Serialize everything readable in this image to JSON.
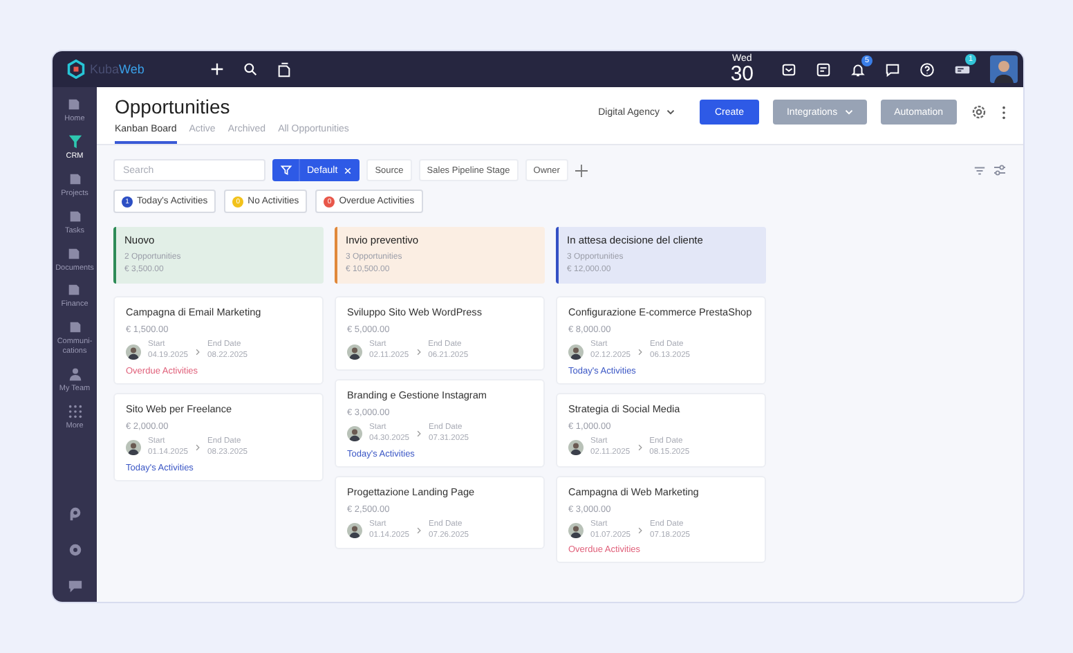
{
  "logo": {
    "first": "Kuba",
    "second": "Web"
  },
  "topbar": {
    "day": "Wed",
    "date": "30",
    "notifications": "5",
    "messages_badge": "1"
  },
  "sidebar": {
    "items": [
      {
        "label": "Home",
        "selected": false
      },
      {
        "label": "CRM",
        "selected": true
      },
      {
        "label": "Projects",
        "selected": false
      },
      {
        "label": "Tasks",
        "selected": false
      },
      {
        "label": "Documents",
        "selected": false
      },
      {
        "label": "Finance",
        "selected": false
      },
      {
        "label": "Communi-\ncations",
        "selected": false
      },
      {
        "label": "My Team",
        "selected": false
      },
      {
        "label": "More",
        "selected": false
      }
    ]
  },
  "header": {
    "title": "Opportunities",
    "tabs": [
      {
        "label": "Kanban Board",
        "selected": true
      },
      {
        "label": "Active",
        "selected": false
      },
      {
        "label": "Archived",
        "selected": false
      },
      {
        "label": "All Opportunities",
        "selected": false
      }
    ],
    "workspace": "Digital Agency",
    "buttons": [
      {
        "label": "Create",
        "kind": "primary"
      },
      {
        "label": "Integrations",
        "kind": "dropdown"
      },
      {
        "label": "Automation",
        "kind": "secondary"
      }
    ]
  },
  "filters": {
    "search_placeholder": "Search",
    "active_filter": "Default",
    "options": [
      "Source",
      "Sales Pipeline Stage",
      "Owner"
    ]
  },
  "activity_filters": [
    {
      "count": "1",
      "label": "Today's Activities",
      "color": "#2d4fc4"
    },
    {
      "count": "0",
      "label": "No Activities",
      "color": "#f2c21b"
    },
    {
      "count": "0",
      "label": "Overdue Activities",
      "color": "#e8574a"
    }
  ],
  "columns": [
    {
      "title": "Nuovo",
      "count": "2 Opportunities",
      "total": "€ 3,500.00",
      "color": "#2e8b57",
      "cards": [
        {
          "title": "Campagna di Email Marketing",
          "amount": "€ 1,500.00",
          "start_label": "Start",
          "start": "04.19.2025",
          "end_label": "End Date",
          "end": "08.22.2025",
          "activity": {
            "kind": "overdue",
            "label": "Overdue Activities"
          }
        },
        {
          "title": "Sito Web per Freelance",
          "amount": "€ 2,000.00",
          "start_label": "Start",
          "start": "01.14.2025",
          "end_label": "End Date",
          "end": "08.23.2025",
          "activity": {
            "kind": "today",
            "label": "Today's Activities"
          }
        }
      ]
    },
    {
      "title": "Invio preventivo",
      "count": "3 Opportunities",
      "total": "€ 10,500.00",
      "color": "#e0883a",
      "cards": [
        {
          "title": "Sviluppo Sito Web WordPress",
          "amount": "€ 5,000.00",
          "start_label": "Start",
          "start": "02.11.2025",
          "end_label": "End Date",
          "end": "06.21.2025"
        },
        {
          "title": "Branding e Gestione Instagram",
          "amount": "€ 3,000.00",
          "start_label": "Start",
          "start": "04.30.2025",
          "end_label": "End Date",
          "end": "07.31.2025",
          "activity": {
            "kind": "today",
            "label": "Today's Activities"
          }
        },
        {
          "title": "Progettazione Landing Page",
          "amount": "€ 2,500.00",
          "start_label": "Start",
          "start": "01.14.2025",
          "end_label": "End Date",
          "end": "07.26.2025"
        }
      ]
    },
    {
      "title": "In attesa decisione del cliente",
      "count": "3 Opportunities",
      "total": "€ 12,000.00",
      "color": "#3450c4",
      "cards": [
        {
          "title": "Configurazione E-commerce PrestaShop",
          "amount": "€ 8,000.00",
          "start_label": "Start",
          "start": "02.12.2025",
          "end_label": "End Date",
          "end": "06.13.2025",
          "activity": {
            "kind": "today",
            "label": "Today's Activities"
          }
        },
        {
          "title": "Strategia di Social Media",
          "amount": "€ 1,000.00",
          "start_label": "Start",
          "start": "02.11.2025",
          "end_label": "End Date",
          "end": "08.15.2025"
        },
        {
          "title": "Campagna di Web Marketing",
          "amount": "€ 3,000.00",
          "start_label": "Start",
          "start": "01.07.2025",
          "end_label": "End Date",
          "end": "07.18.2025",
          "activity": {
            "kind": "overdue",
            "label": "Overdue Activities"
          }
        }
      ]
    }
  ]
}
